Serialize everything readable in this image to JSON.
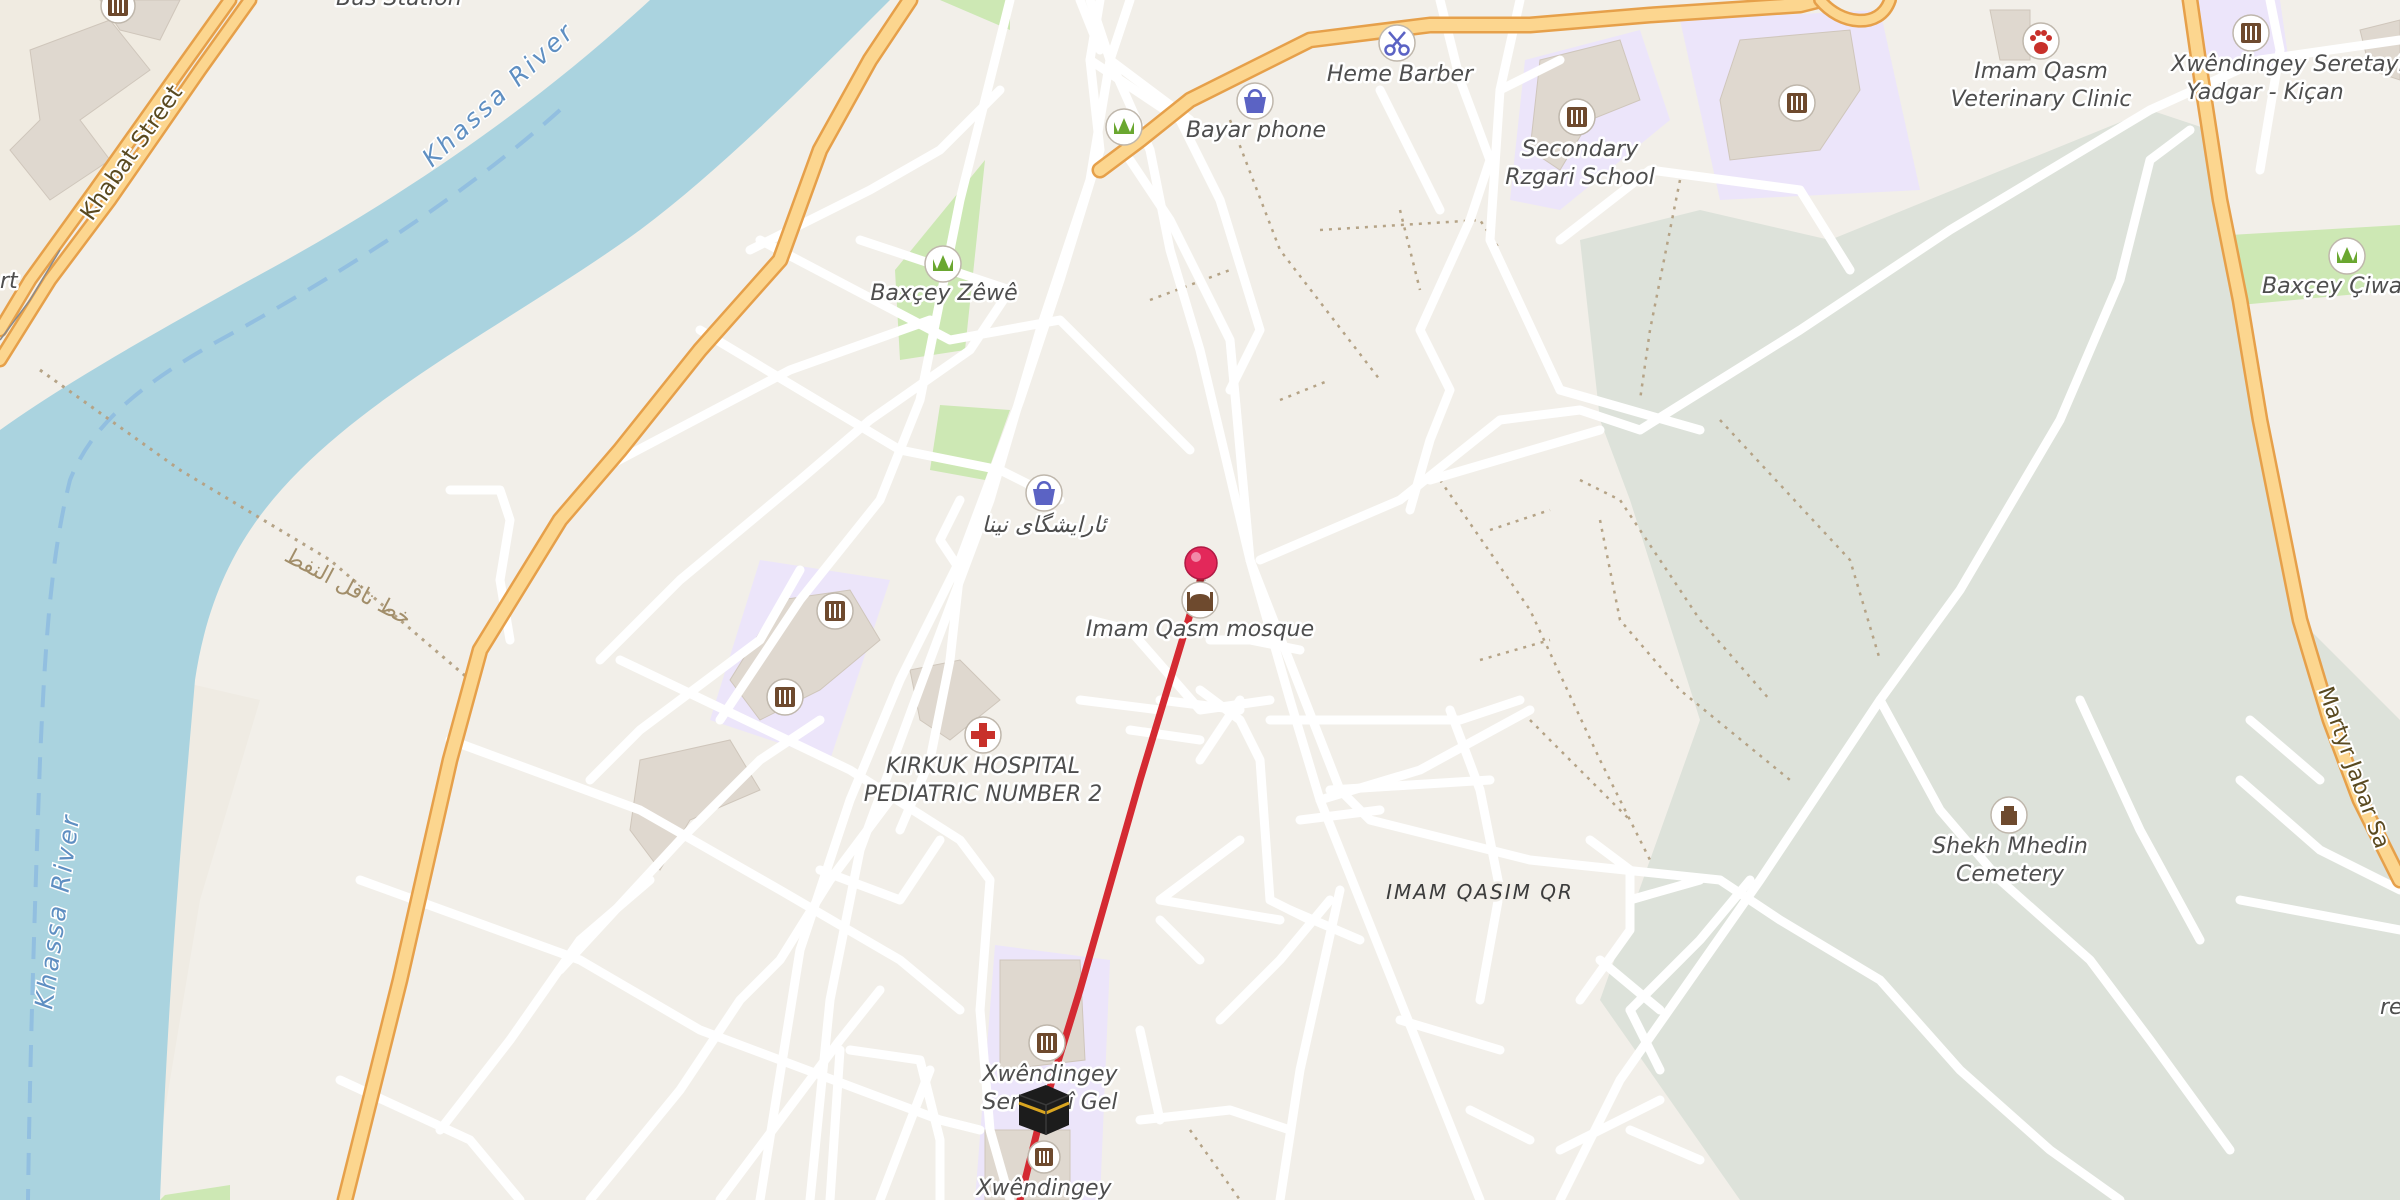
{
  "map": {
    "labels": {
      "bus_station": "Bus Station",
      "khabat_street": "Khabat Street",
      "khassa_river_top": "Khassa River",
      "khassa_river_left": "Khassa River",
      "heme_barber": "Heme Barber",
      "bayar_phone": "Bayar phone",
      "secondary_rzgari": [
        "Secondary",
        "Rzgari School"
      ],
      "imam_qasm_vet": [
        "Imam Qasm",
        "Veterinary Clinic"
      ],
      "xwendingey_yadgar": [
        "Xwêndingey Seretayî",
        "Yadgar - Kiçan"
      ],
      "baxcey_zewe": "Baxçey Zêwê",
      "baxcey_ciwar": "Baxçey Çiwar",
      "arabic_shop": "ئارایشگای نینا",
      "imam_mosque": "Imam Qasm mosque",
      "hospital": [
        "KIRKUK HOSPITAL",
        "PEDIATRIC NUMBER 2"
      ],
      "imam_qasim_qr": "IMAM QASIM QR",
      "shekh_cemetery": [
        "Shekh Mhedin",
        "Cemetery"
      ],
      "xwendingey_gel": [
        "Xwêndingey",
        "Seretayî Gel"
      ],
      "xwendingey_bottom": "Xwêndingey",
      "martyr_street": "Martyr Jabar Sa",
      "left_edge_fragment": "rt",
      "right_edge_fragment": "re",
      "pipeline_text": "خط ناقل النفط"
    },
    "icons": {
      "school": "school-icon",
      "park": "park-icon",
      "shop": "shop-icon",
      "barber": "barber-icon",
      "hospital": "hospital-icon",
      "vet": "veterinary-icon",
      "mosque": "mosque-icon",
      "cemetery": "cemetery-icon",
      "destination": "destination-pin-icon",
      "kaaba": "kaaba-icon"
    },
    "colors": {
      "land": "#f2efe9",
      "water": "#aad3df",
      "road_major": "#f9b255",
      "road_major_fill": "#fcd68f",
      "road_minor": "#ffffff",
      "school_area": "#ece5fa",
      "park": "#cde8b4",
      "cemetery": "#dde2da",
      "building": "#dfd8cf",
      "route": "#d42a32",
      "pin": "#e3285a"
    }
  }
}
